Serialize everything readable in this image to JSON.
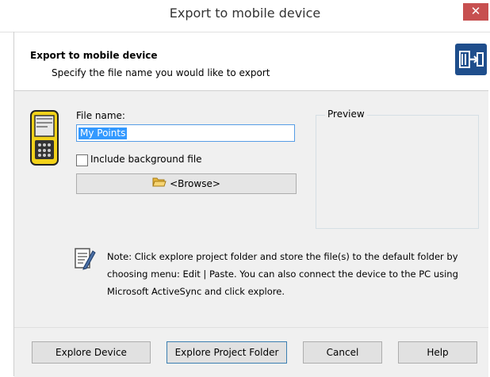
{
  "window": {
    "title": "Export to mobile device",
    "close_glyph": "✕"
  },
  "header": {
    "title": "Export to mobile device",
    "subtitle": "Specify the file name you would like to export",
    "icon": "export-device-icon"
  },
  "form": {
    "file_name_label": "File name:",
    "file_name_value": "My Points",
    "include_background_label": "Include background file",
    "include_background_checked": false,
    "browse_label": "<Browse>",
    "preview_label": "Preview"
  },
  "note": {
    "icon": "note-icon",
    "text": "Note: Click explore project folder and store the file(s) to the default folder by choosing menu: Edit | Paste. You can also connect the device to the PC using Microsoft ActiveSync and click explore."
  },
  "footer": {
    "explore_device": "Explore Device",
    "explore_project_folder": "Explore Project Folder",
    "cancel": "Cancel",
    "help": "Help"
  },
  "colors": {
    "accent": "#3399ff",
    "close": "#c75050",
    "header_icon": "#1f4e8c"
  }
}
